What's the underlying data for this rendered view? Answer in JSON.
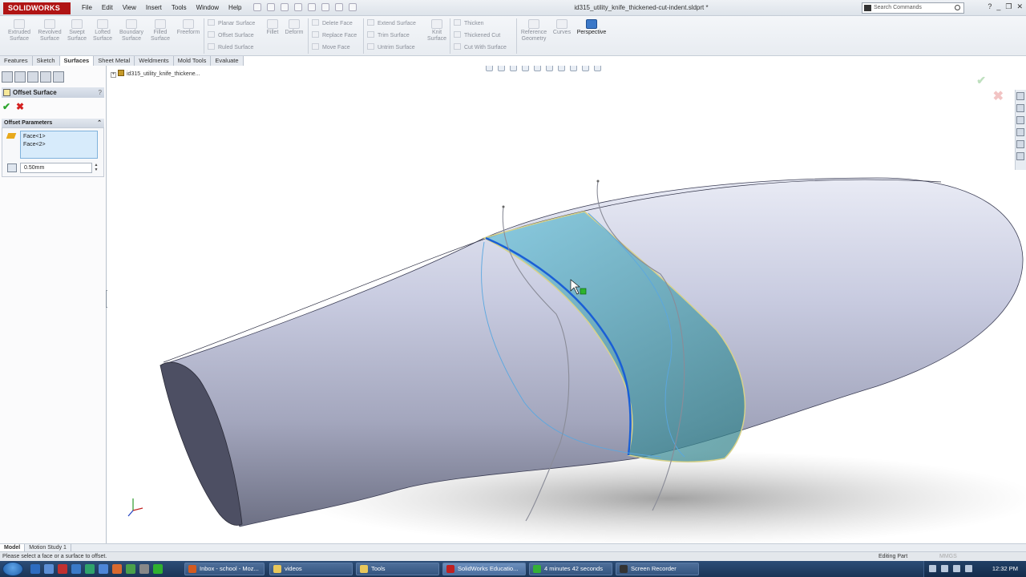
{
  "app": {
    "logo_text": "SOLIDWORKS",
    "doc_title": "id315_utility_knife_thickened-cut-indent.sldprt *",
    "search_placeholder": "Search Commands"
  },
  "menu": [
    "File",
    "Edit",
    "View",
    "Insert",
    "Tools",
    "Window",
    "Help"
  ],
  "ribbon": {
    "big_buttons": [
      {
        "label": "Extruded\nSurface"
      },
      {
        "label": "Revolved\nSurface"
      },
      {
        "label": "Swept\nSurface"
      },
      {
        "label": "Lofted\nSurface"
      },
      {
        "label": "Boundary\nSurface"
      },
      {
        "label": "Filled\nSurface"
      },
      {
        "label": "Freeform"
      }
    ],
    "col1": [
      "Planar Surface",
      "Offset Surface",
      "Ruled Surface"
    ],
    "fillet": "Fillet",
    "deform": "Deform",
    "col2": [
      "Delete Face",
      "Replace Face",
      "Move Face"
    ],
    "col3": [
      "Extend Surface",
      "Trim Surface",
      "Untrim Surface"
    ],
    "knit": "Knit\nSurface",
    "col4": [
      "Thicken",
      "Thickened Cut",
      "Cut With Surface"
    ],
    "ref_geom": "Reference\nGeometry",
    "curves": "Curves",
    "perspective": "Perspective"
  },
  "tabs": [
    "Features",
    "Sketch",
    "Surfaces",
    "Sheet Metal",
    "Weldments",
    "Mold Tools",
    "Evaluate"
  ],
  "active_tab": "Surfaces",
  "panel": {
    "title": "Offset Surface",
    "help": "?",
    "group": "Offset Parameters",
    "faces": [
      "Face<1>",
      "Face<2>"
    ],
    "distance": "0.50mm"
  },
  "tree_node": "id315_utility_knife_thickene...",
  "model_tabs": [
    "Model",
    "Motion Study 1"
  ],
  "status": {
    "message": "Please select a face or a surface to offset.",
    "mode": "Editing Part",
    "units": "MMGS"
  },
  "taskbar": {
    "items": [
      {
        "label": "Inbox - school - Moz...",
        "color": "#d35a1f"
      },
      {
        "label": "videos",
        "color": "#e8c75a"
      },
      {
        "label": "Tools",
        "color": "#e8c75a"
      },
      {
        "label": "SolidWorks Educatio...",
        "color": "#c02020"
      },
      {
        "label": "4 minutes 42 seconds",
        "color": "#35b035"
      },
      {
        "label": "Screen Recorder",
        "color": "#333333"
      }
    ],
    "clock": "12:32 PM"
  },
  "colors": {
    "accent_brand": "#b01414",
    "surface_highlight": "#3f9ecb",
    "edge_select": "#1a5fd6"
  }
}
